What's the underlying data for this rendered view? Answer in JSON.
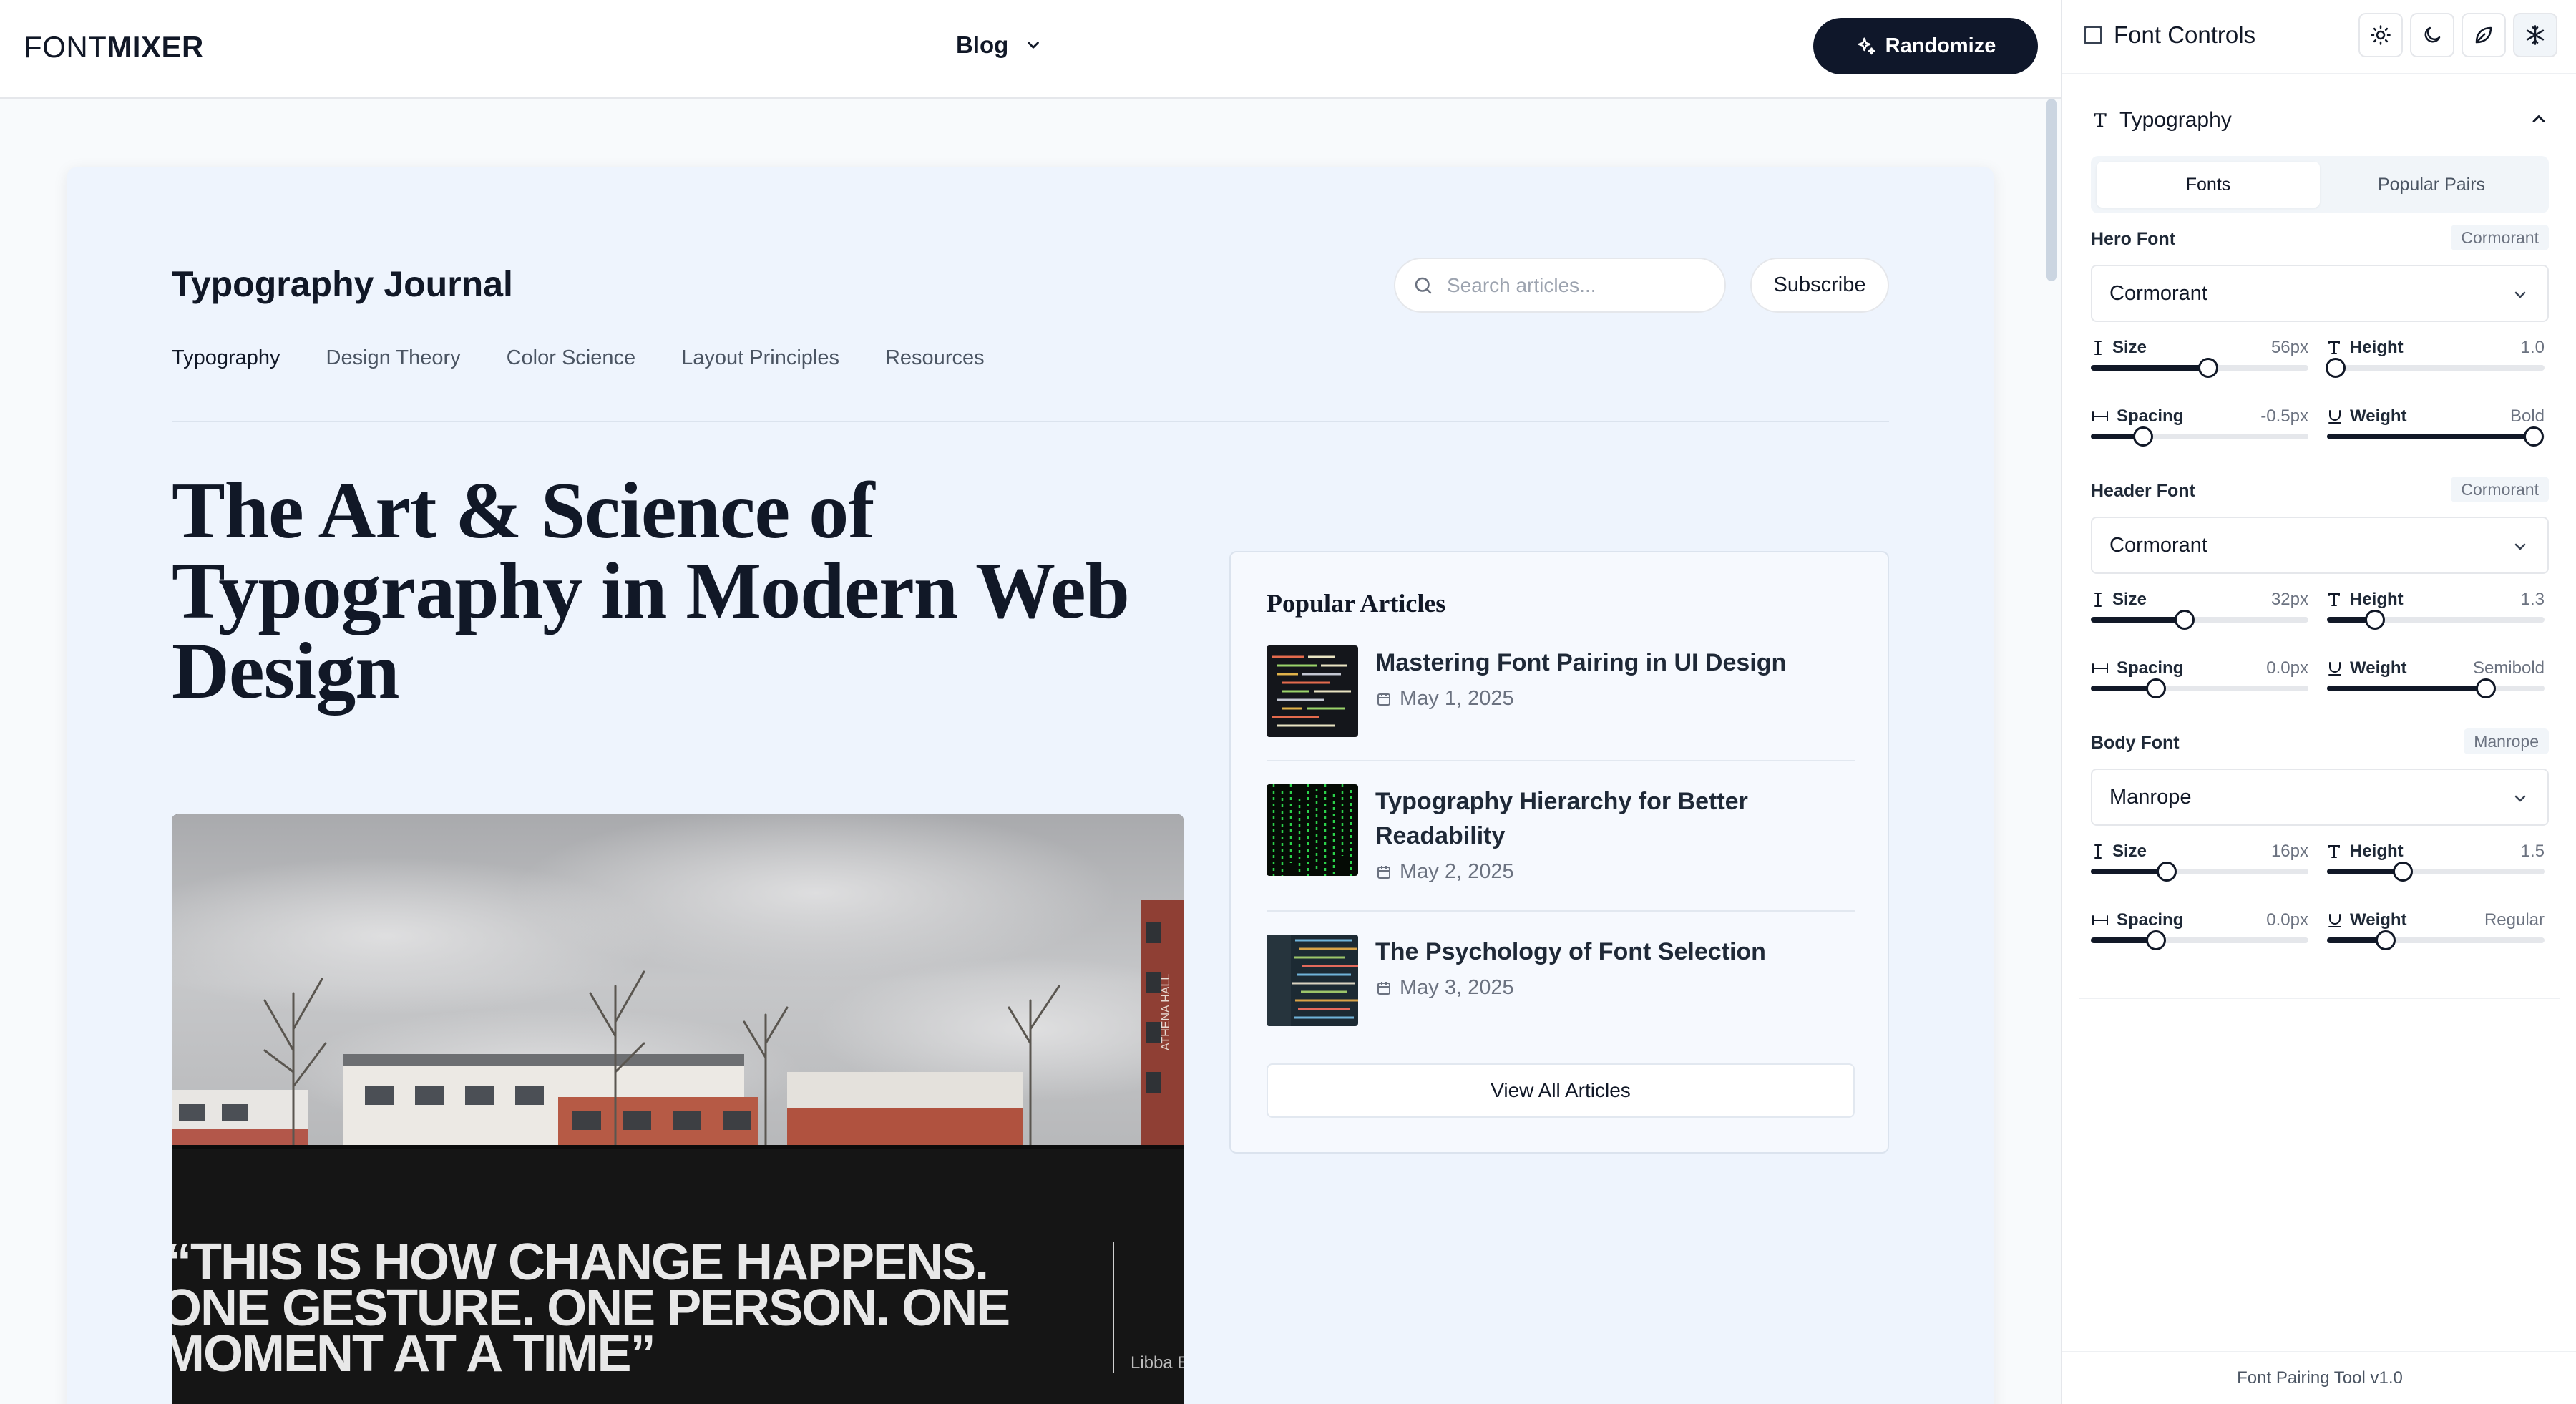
{
  "header": {
    "logo_light": "FONT",
    "logo_bold": "MIXER",
    "menu_label": "Blog",
    "randomize_label": "Randomize"
  },
  "site": {
    "title": "Typography Journal",
    "search_placeholder": "Search articles...",
    "subscribe_label": "Subscribe",
    "nav": [
      "Typography",
      "Design Theory",
      "Color Science",
      "Layout Principles",
      "Resources"
    ],
    "active_nav": "Typography"
  },
  "hero": {
    "title": "The Art & Science of Typography in Modern Web Design",
    "image_quote_line1": "“THIS IS HOW CHANGE HAPPENS.",
    "image_quote_line2": "ONE GESTURE. ONE PERSON. ONE",
    "image_quote_line3": "MOMENT AT A TIME”",
    "image_sign": "ATHENA HALL",
    "image_credit": "Libba B"
  },
  "popular": {
    "title": "Popular Articles",
    "articles": [
      {
        "title": "Mastering Font Pairing in UI Design",
        "date": "May 1, 2025"
      },
      {
        "title": "Typography Hierarchy for Better Readability",
        "date": "May 2, 2025"
      },
      {
        "title": "The Psychology of Font Selection",
        "date": "May 3, 2025"
      }
    ],
    "view_all_label": "View All Articles"
  },
  "panel": {
    "title": "Font Controls",
    "section_title": "Typography",
    "tabs": [
      "Fonts",
      "Popular Pairs"
    ],
    "active_tab": "Fonts",
    "groups": [
      {
        "label": "Hero Font",
        "badge": "Cormorant",
        "selected": "Cormorant",
        "controls": [
          {
            "label": "Size",
            "value": "56px",
            "level": 0.54
          },
          {
            "label": "Height",
            "value": "1.0",
            "level": 0.04
          },
          {
            "label": "Spacing",
            "value": "-0.5px",
            "level": 0.24
          },
          {
            "label": "Weight",
            "value": "Bold",
            "level": 0.95
          }
        ]
      },
      {
        "label": "Header Font",
        "badge": "Cormorant",
        "selected": "Cormorant",
        "controls": [
          {
            "label": "Size",
            "value": "32px",
            "level": 0.43
          },
          {
            "label": "Height",
            "value": "1.3",
            "level": 0.22
          },
          {
            "label": "Spacing",
            "value": "0.0px",
            "level": 0.3
          },
          {
            "label": "Weight",
            "value": "Semibold",
            "level": 0.73
          }
        ]
      },
      {
        "label": "Body Font",
        "badge": "Manrope",
        "selected": "Manrope",
        "controls": [
          {
            "label": "Size",
            "value": "16px",
            "level": 0.35
          },
          {
            "label": "Height",
            "value": "1.5",
            "level": 0.35
          },
          {
            "label": "Spacing",
            "value": "0.0px",
            "level": 0.3
          },
          {
            "label": "Weight",
            "value": "Regular",
            "level": 0.27
          }
        ]
      }
    ],
    "footer": "Font Pairing Tool v1.0"
  },
  "colors": {
    "accent": "#0f172a",
    "card_bg": "#eef4fd",
    "page_bg": "#f8fafc"
  },
  "icons": {
    "randomize": "sparkles-icon",
    "search": "search-icon",
    "calendar": "calendar-icon",
    "theme_buttons": [
      "sun-icon",
      "moon-icon",
      "leaf-icon",
      "snowflake-icon"
    ]
  }
}
